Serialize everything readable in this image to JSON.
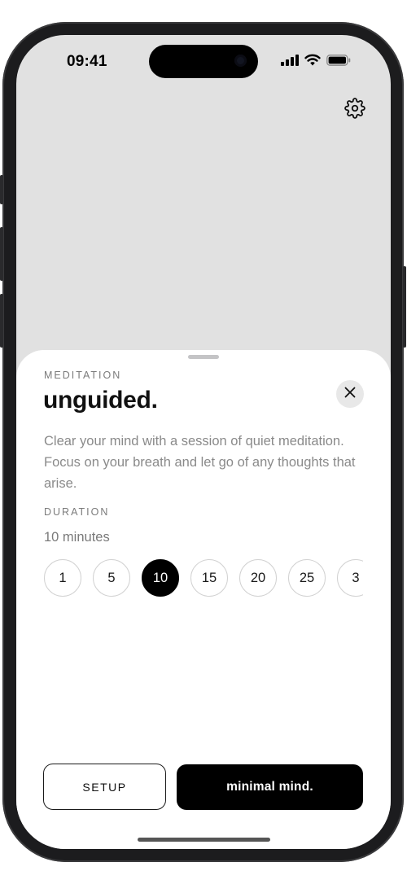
{
  "status_bar": {
    "time": "09:41",
    "icons": [
      "cellular-signal-icon",
      "wifi-icon",
      "battery-icon"
    ]
  },
  "header": {
    "settings_icon": "gear-icon"
  },
  "sheet": {
    "eyebrow": "MEDITATION",
    "title": "unguided.",
    "close_icon": "close-icon",
    "description": "Clear your mind with a session of quiet meditation. Focus on your breath and let go of any thoughts that arise.",
    "duration_label": "DURATION",
    "duration_value": "10 minutes",
    "duration_options": [
      "1",
      "5",
      "10",
      "15",
      "20",
      "25",
      "3"
    ],
    "selected_duration": "10",
    "setup_label": "SETUP",
    "start_label": "minimal mind."
  },
  "colors": {
    "background": "#e1e1e1",
    "sheet": "#ffffff",
    "accent": "#000000",
    "muted_text": "#8a8a8a"
  }
}
